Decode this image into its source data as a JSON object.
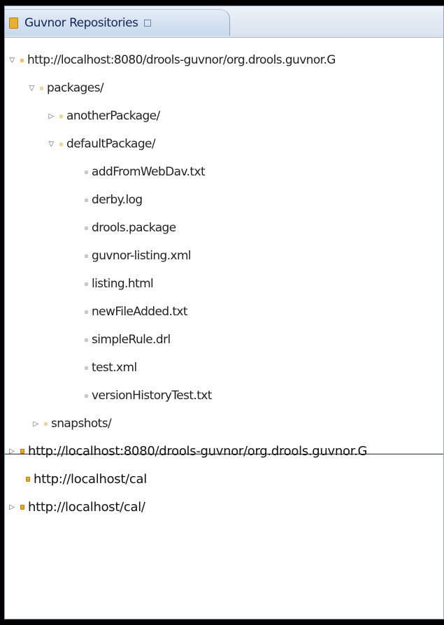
{
  "view": {
    "tab_title": "Guvnor Repositories",
    "tab_icon": "guvnor-repo-icon"
  },
  "tree": [
    {
      "label": "http://localhost:8080/drools-guvnor/org.drools.guvnor.G",
      "kind": "repo",
      "expanded": true,
      "depth": 0
    },
    {
      "label": "packages/",
      "kind": "folder",
      "expanded": true,
      "depth": 1
    },
    {
      "label": "anotherPackage/",
      "kind": "folder",
      "expanded": false,
      "depth": 2
    },
    {
      "label": "defaultPackage/",
      "kind": "folder",
      "expanded": true,
      "depth": 2
    },
    {
      "label": "addFromWebDav.txt",
      "kind": "file",
      "depth": 3
    },
    {
      "label": "derby.log",
      "kind": "file",
      "depth": 3
    },
    {
      "label": "drools.package",
      "kind": "file",
      "depth": 3
    },
    {
      "label": "guvnor-listing.xml",
      "kind": "file",
      "depth": 3
    },
    {
      "label": "listing.html",
      "kind": "file",
      "depth": 3
    },
    {
      "label": "newFileAdded.txt",
      "kind": "file",
      "depth": 3
    },
    {
      "label": "simpleRule.drl",
      "kind": "file",
      "depth": 3
    },
    {
      "label": "test.xml",
      "kind": "file",
      "depth": 3
    },
    {
      "label": "versionHistoryTest.txt",
      "kind": "file",
      "depth": 3
    },
    {
      "label": "snapshots/",
      "kind": "folder",
      "expanded": false,
      "depth": 1
    },
    {
      "label": "http://localhost:8080/drools-guvnor/org.drools.guvnor.G",
      "kind": "repo",
      "expanded": false,
      "depth": 0
    },
    {
      "label": "http://localhost/cal",
      "kind": "repo",
      "depth": 0
    },
    {
      "label": "http://localhost/cal/",
      "kind": "repo",
      "expanded": false,
      "depth": 0
    }
  ]
}
